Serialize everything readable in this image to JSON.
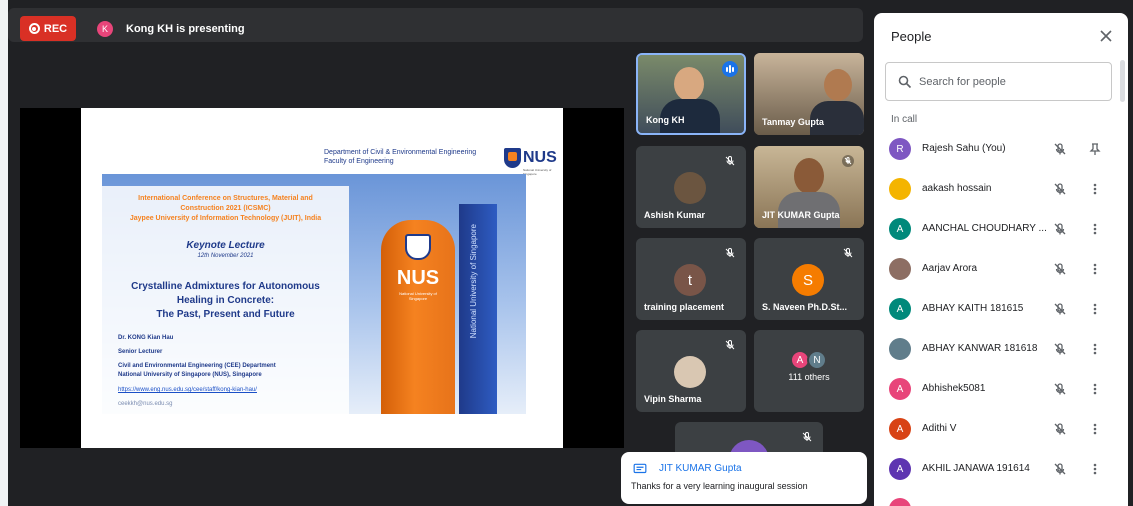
{
  "topbar": {
    "rec_label": "REC",
    "presenter_initial": "K",
    "presenting_text": "Kong KH is presenting"
  },
  "slide": {
    "dept_line1": "Department of Civil & Environmental Engineering",
    "dept_line2": "Faculty of Engineering",
    "logo_text": "NUS",
    "logo_sub": "National University of Singapore",
    "conf_line1": "International Conference on Structures, Material and",
    "conf_line2": "Construction 2021 (ICSMC)",
    "conf_line3": "Jaypee University of Information Technology (JUIT), India",
    "keynote": "Keynote Lecture",
    "date": "12th November 2021",
    "title_line1": "Crystalline Admixtures for Autonomous",
    "title_line2": "Healing in Concrete:",
    "title_line3": "The Past, Present and Future",
    "speaker": "Dr. KONG Kian Hau",
    "role": "Senior Lecturer",
    "affil1": "Civil and Environmental Engineering (CEE) Department",
    "affil2": "National University of Singapore (NUS), Singapore",
    "url": "https://www.eng.nus.edu.sg/cee/staff/kong-kian-hau/",
    "email": "ceekkh@nus.edu.sg",
    "tower_text": "NUS",
    "tower_sub": "National University of Singapore",
    "sign_text": "National University of Singapore"
  },
  "tiles": [
    {
      "name": "Kong KH"
    },
    {
      "name": "Tanmay Gupta"
    },
    {
      "name": "Ashish Kumar"
    },
    {
      "name": "JIT KUMAR Gupta"
    },
    {
      "name": "training placement",
      "initial": "t"
    },
    {
      "name": "S. Naveen Ph.D.St...",
      "initial": "S"
    },
    {
      "name": "Vipin Sharma"
    },
    {
      "name": "111 others",
      "initials": [
        "A",
        "N"
      ]
    }
  ],
  "chat_toast": {
    "author": "JIT KUMAR Gupta",
    "message": "Thanks for a very learning inaugural session"
  },
  "people_panel": {
    "title": "People",
    "search_placeholder": "Search for people",
    "section_label": "In call",
    "people": [
      {
        "name": "Rajesh Sahu (You)",
        "initial": "R",
        "color": "#7e57c2"
      },
      {
        "name": "aakash hossain",
        "initial": "",
        "color": "#f4b400"
      },
      {
        "name": "AANCHAL CHOUDHARY ...",
        "initial": "A",
        "color": "#00897b"
      },
      {
        "name": "Aarjav Arora",
        "initial": "",
        "color": "#8d6e63"
      },
      {
        "name": "ABHAY KAITH 181615",
        "initial": "A",
        "color": "#00897b"
      },
      {
        "name": "ABHAY KANWAR 181618",
        "initial": "",
        "color": "#607d8b"
      },
      {
        "name": "Abhishek5081",
        "initial": "A",
        "color": "#e8457a"
      },
      {
        "name": "Adithi V",
        "initial": "A",
        "color": "#d84315"
      },
      {
        "name": "AKHIL JANAWA 191614",
        "initial": "A",
        "color": "#5e35b1"
      }
    ]
  },
  "colors": {
    "rec": "#d93025",
    "accent": "#1a73e8",
    "tile_bg": "#3c4043",
    "bg": "#202124"
  }
}
